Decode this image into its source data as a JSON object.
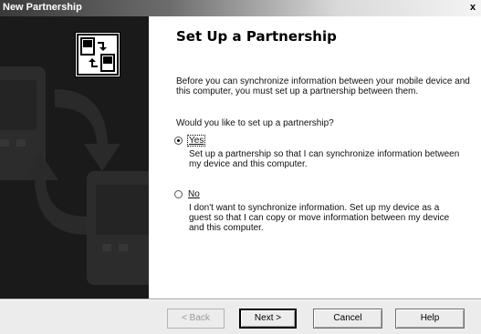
{
  "window": {
    "title": "New Partnership",
    "close_glyph": "x"
  },
  "header": {
    "title": "Set Up a Partnership"
  },
  "body": {
    "intro": "Before you can synchronize information between your mobile device and this computer, you must set up a partnership between them.",
    "question": "Would you like to set up a partnership?",
    "options": [
      {
        "label": "Yes",
        "selected": true,
        "description": "Set up a partnership so that I can synchronize information between my device and this computer."
      },
      {
        "label": "No",
        "selected": false,
        "description": "I don't want to synchronize information. Set up my device as a guest so that I can copy or move information between my device and this computer."
      }
    ]
  },
  "footer": {
    "back_label": "< Back",
    "next_label": "Next >",
    "cancel_label": "Cancel",
    "help_label": "Help"
  },
  "icons": {
    "wizard": "device-sync-icon"
  }
}
